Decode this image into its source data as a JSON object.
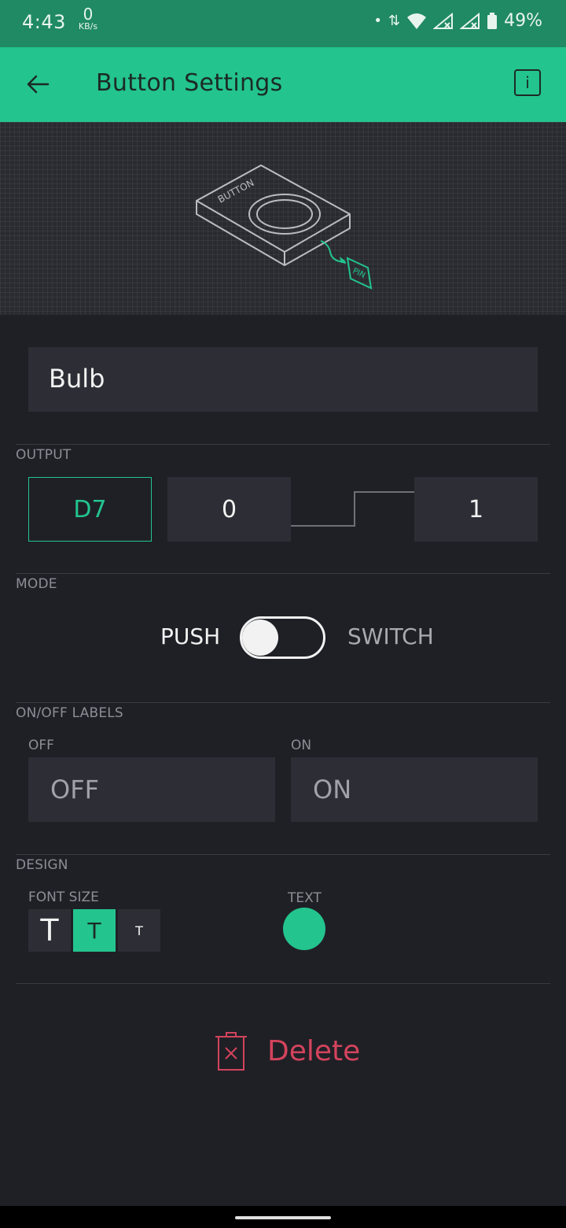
{
  "status_bar": {
    "time": "4:43",
    "speed_value": "0",
    "speed_unit": "KB/s",
    "battery": "49%"
  },
  "app_bar": {
    "title": "Button Settings"
  },
  "preview": {
    "device_label": "BUTTON",
    "pin_label": "PIN"
  },
  "name_field": {
    "value": "Bulb"
  },
  "output": {
    "section_label": "OUTPUT",
    "pin": "D7",
    "low_value": "0",
    "high_value": "1"
  },
  "mode": {
    "section_label": "MODE",
    "push_label": "PUSH",
    "switch_label": "SWITCH",
    "selected": "PUSH"
  },
  "labels": {
    "section_label": "ON/OFF LABELS",
    "off_caption": "OFF",
    "on_caption": "ON",
    "off_value": "OFF",
    "on_value": "ON"
  },
  "design": {
    "section_label": "DESIGN",
    "font_size_label": "FONT SIZE",
    "text_label": "TEXT",
    "font_sizes": [
      "T",
      "T",
      "T"
    ],
    "selected_font_size_index": 1,
    "text_color": "#23c48e"
  },
  "delete": {
    "label": "Delete"
  },
  "colors": {
    "accent": "#23c48e",
    "danger": "#d3435c",
    "background": "#1f2026",
    "field": "#2d2e35"
  }
}
